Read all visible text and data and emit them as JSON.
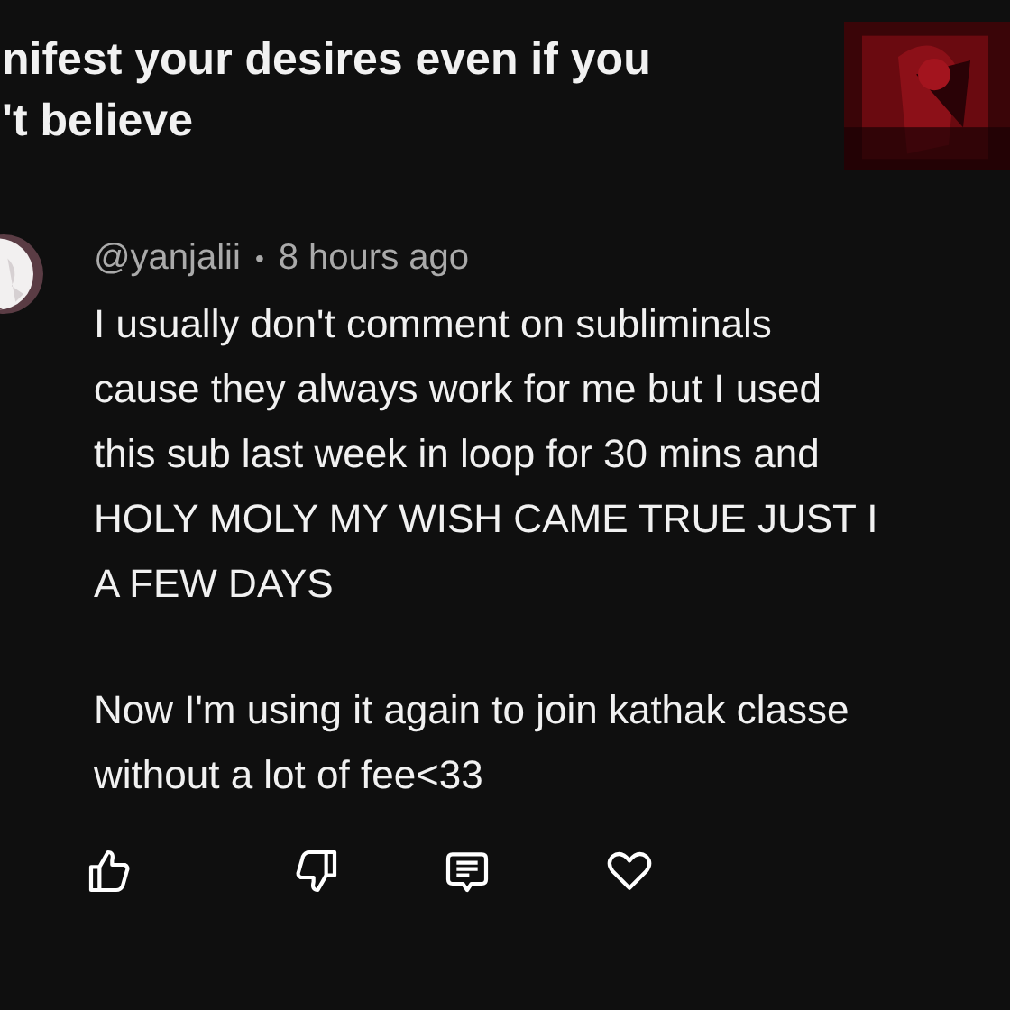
{
  "video": {
    "title_lines": [
      "nifest your desires even if you",
      "'t believe"
    ]
  },
  "comment": {
    "author": "@yanjalii",
    "separator": "•",
    "time": "8 hours ago",
    "paragraphs": [
      [
        "I usually don't comment on subliminals",
        "cause they always work for me but I used",
        "this sub last week in loop for 30 mins and",
        "HOLY MOLY MY WISH CAME TRUE JUST I",
        "A FEW DAYS"
      ],
      [
        "Now I'm using it again to join  kathak classe",
        "without a lot of fee<33"
      ]
    ],
    "actions": [
      {
        "kind": "like"
      },
      {
        "kind": "dislike"
      },
      {
        "kind": "reply"
      },
      {
        "kind": "heart"
      }
    ]
  }
}
